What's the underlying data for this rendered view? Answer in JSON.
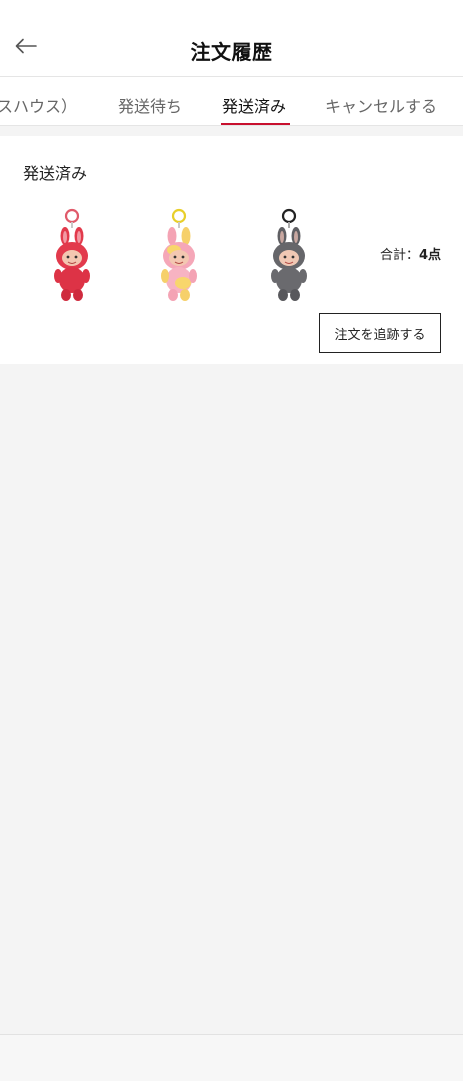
{
  "header": {
    "title": "注文履歴",
    "back_icon": "arrow-left-icon"
  },
  "tabs": [
    {
      "label": "スハウス）",
      "active": false
    },
    {
      "label": "発送待ち",
      "active": false
    },
    {
      "label": "発送済み",
      "active": true
    },
    {
      "label": "キャンセルする",
      "active": false
    }
  ],
  "accent_color": "#c8102e",
  "order": {
    "status": "発送済み",
    "products": [
      {
        "name": "red-plush-keychain",
        "color": "#e8404f"
      },
      {
        "name": "pink-yellow-plush-keychain",
        "color": "#f3a0a8"
      },
      {
        "name": "gray-plush-keychain",
        "color": "#6f6f73"
      }
    ],
    "total_prefix": "合計：",
    "total_count": "4点",
    "track_button": "注文を追跡する"
  }
}
